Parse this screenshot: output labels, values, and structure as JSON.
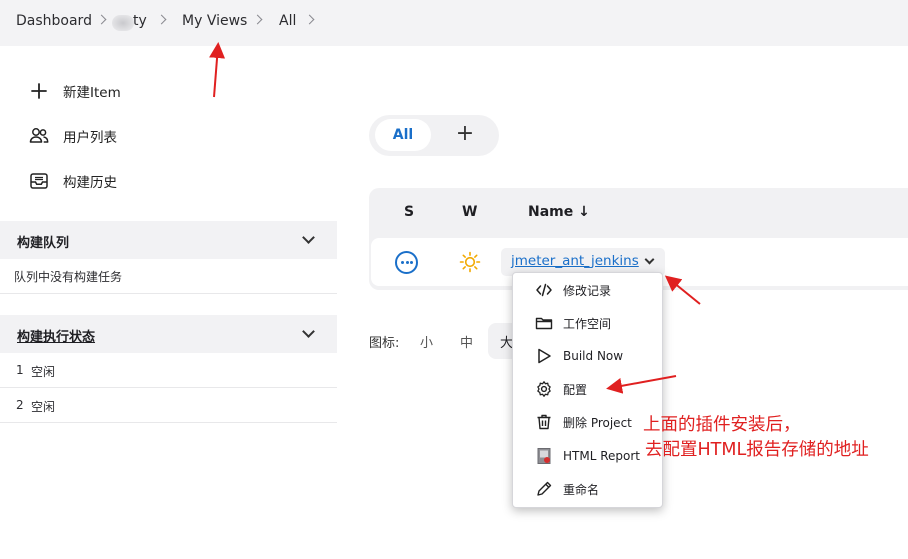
{
  "breadcrumb": {
    "items": [
      "Dashboard",
      "ty",
      "My Views",
      "All"
    ]
  },
  "side_tasks": [
    {
      "label": "新建Item",
      "icon": "plus-icon"
    },
    {
      "label": "用户列表",
      "icon": "people-icon"
    },
    {
      "label": "构建历史",
      "icon": "inbox-icon"
    }
  ],
  "build_queue": {
    "title": "构建队列",
    "empty_text": "队列中没有构建任务"
  },
  "executors": {
    "title": "构建执行状态",
    "rows": [
      {
        "num": "1",
        "status": "空闲"
      },
      {
        "num": "2",
        "status": "空闲"
      }
    ]
  },
  "tabs": {
    "active": "All",
    "add": "+"
  },
  "table": {
    "headers": {
      "s": "S",
      "w": "W",
      "name": "Name ↓"
    },
    "rows": [
      {
        "status_icon": "ellipsis-circle-icon",
        "weather_icon": "sun-icon",
        "name": "jmeter_ant_jenkins"
      }
    ]
  },
  "icon_size": {
    "label": "图标:",
    "options": [
      "小",
      "中",
      "大"
    ]
  },
  "job_menu": [
    {
      "label": "修改记录",
      "icon": "code-icon"
    },
    {
      "label": "工作空间",
      "icon": "folder-icon"
    },
    {
      "label": "Build Now",
      "icon": "play-icon"
    },
    {
      "label": "配置",
      "icon": "gear-icon"
    },
    {
      "label": "删除 Project",
      "icon": "trash-icon"
    },
    {
      "label": "HTML Report",
      "icon": "report-icon"
    },
    {
      "label": "重命名",
      "icon": "pencil-icon"
    }
  ],
  "annotation": {
    "line1": "上面的插件安装后，",
    "line2": "去配置HTML报告存储的地址",
    "color": "#e02020"
  },
  "colors": {
    "accent": "#1a6fc9",
    "sun": "#f2a900"
  }
}
